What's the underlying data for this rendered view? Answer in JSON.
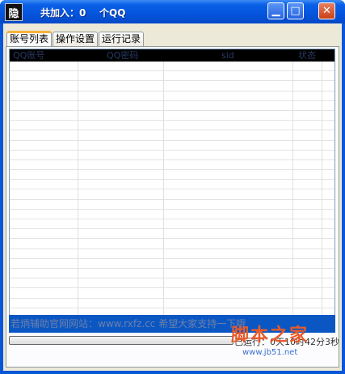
{
  "window": {
    "icon_glyph": "隐",
    "title": "共加入：0    个QQ",
    "controls": {
      "minimize": "▁",
      "maximize": "□",
      "close": "✕"
    }
  },
  "tabs": [
    {
      "label": "账号列表",
      "active": true
    },
    {
      "label": "操作设置",
      "active": false
    },
    {
      "label": "运行记录",
      "active": false
    }
  ],
  "table": {
    "columns": [
      "QQ账号",
      "QQ密码",
      "sid",
      "状态"
    ],
    "rows": []
  },
  "status": {
    "message": "若炳辅助官网网站：www.rxfz.cc 希望大家支持一下哦",
    "progress": 0,
    "runtime": "已运行：0天10时42分3秒"
  },
  "watermark": {
    "logo": "脚本之家",
    "url": "www.jb51.net"
  }
}
